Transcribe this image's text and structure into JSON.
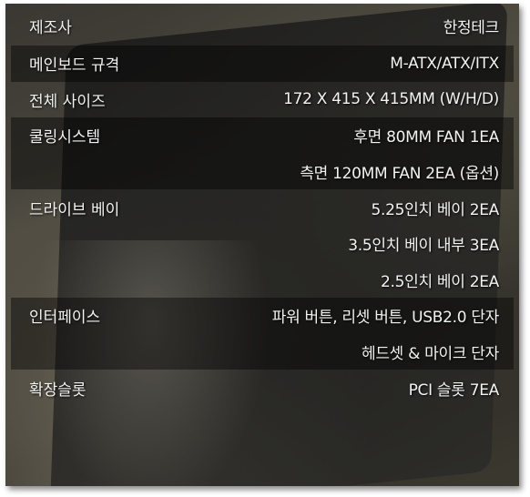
{
  "specs": [
    {
      "label": "제조사",
      "value": "한정테크",
      "shaded": false
    },
    {
      "label": "메인보드 규격",
      "value": "M-ATX/ATX/ITX",
      "shaded": true
    },
    {
      "label": "전체 사이즈",
      "value": "172 X 415 X 415MM (W/H/D)",
      "shaded": false
    },
    {
      "label": "쿨링시스템",
      "value": "후면 80MM FAN 1EA",
      "shaded": true
    },
    {
      "label": "",
      "value": "측면 120MM FAN 2EA (옵션)",
      "shaded": true
    },
    {
      "label": "드라이브 베이",
      "value": "5.25인치 베이 2EA",
      "shaded": false
    },
    {
      "label": "",
      "value": "3.5인치 베이 내부 3EA",
      "shaded": false
    },
    {
      "label": "",
      "value": "2.5인치 베이  2EA",
      "shaded": false
    },
    {
      "label": "인터페이스",
      "value": "파워 버튼, 리셋 버튼, USB2.0 단자",
      "shaded": true
    },
    {
      "label": "",
      "value": "헤드셋 & 마이크 단자",
      "shaded": true
    },
    {
      "label": "확장슬롯",
      "value": "PCI 슬롯 7EA",
      "shaded": false
    }
  ]
}
